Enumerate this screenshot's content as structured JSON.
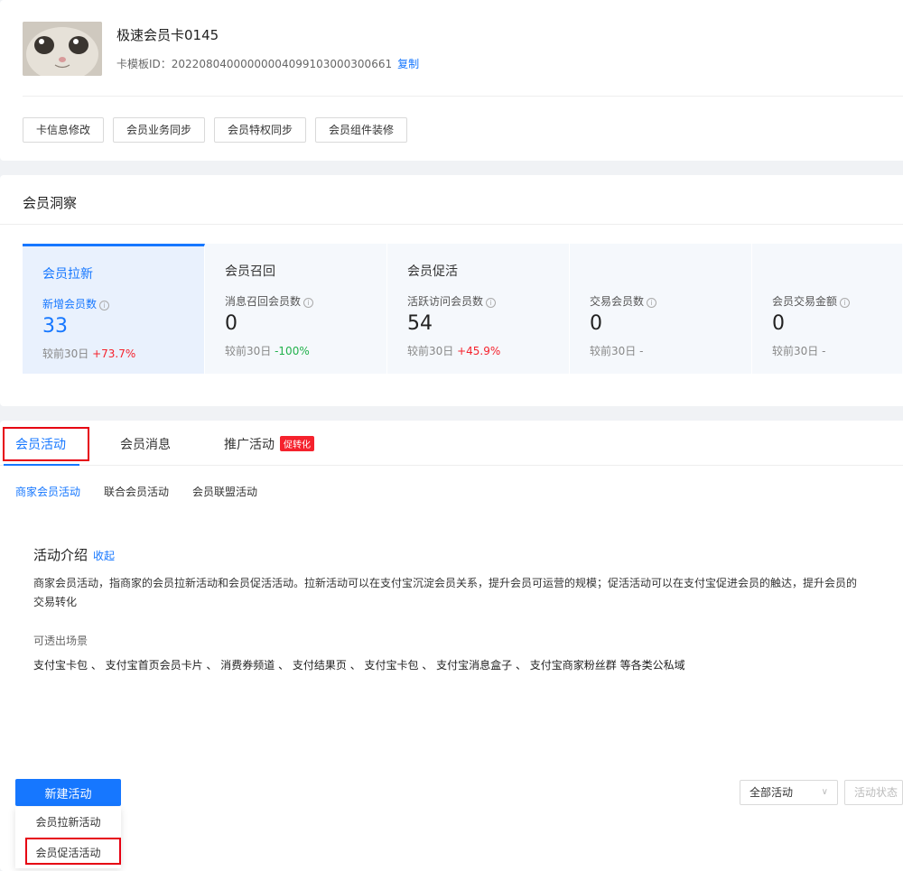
{
  "card": {
    "title": "极速会员卡0145",
    "template_label": "卡模板ID：",
    "template_id": "20220804000000004099103000300661",
    "copy": "复制",
    "buttons": [
      "卡信息修改",
      "会员业务同步",
      "会员特权同步",
      "会员组件装修"
    ]
  },
  "insight": {
    "title": "会员洞察",
    "stats": [
      {
        "group": "会员拉新",
        "label": "新增会员数",
        "value": "33",
        "compare_prefix": "较前30日 ",
        "change": "+73.7%",
        "trend": "up",
        "active": true
      },
      {
        "group": "会员召回",
        "label": "消息召回会员数",
        "value": "0",
        "compare_prefix": "较前30日 ",
        "change": "-100%",
        "trend": "down",
        "active": false
      },
      {
        "group": "会员促活",
        "label": "活跃访问会员数",
        "value": "54",
        "compare_prefix": "较前30日 ",
        "change": "+45.9%",
        "trend": "up",
        "active": false
      },
      {
        "group": "",
        "label": "交易会员数",
        "value": "0",
        "compare_prefix": "较前30日 ",
        "change": "-",
        "trend": "none",
        "active": false
      },
      {
        "group": "",
        "label": "会员交易金额",
        "value": "0",
        "compare_prefix": "较前30日 ",
        "change": "-",
        "trend": "none",
        "active": false
      }
    ]
  },
  "tabs": {
    "items": [
      "会员活动",
      "会员消息",
      "推广活动"
    ],
    "promo_badge": "促转化"
  },
  "subtabs": [
    "商家会员活动",
    "联合会员活动",
    "会员联盟活动"
  ],
  "intro": {
    "title": "活动介绍",
    "collapse": "收起",
    "text": "商家会员活动，指商家的会员拉新活动和会员促活活动。拉新活动可以在支付宝沉淀会员关系，提升会员可运营的规模；促活活动可以在支付宝促进会员的触达，提升会员的交易转化",
    "scene_title": "可透出场景",
    "scenes": "支付宝卡包 、 支付宝首页会员卡片 、 消费券频道 、 支付结果页 、 支付宝卡包 、 支付宝消息盒子 、 支付宝商家粉丝群 等各类公私域"
  },
  "actions": {
    "new_button": "新建活动",
    "menu": [
      "会员拉新活动",
      "会员促活活动"
    ],
    "filter_all": "全部活动",
    "filter_status": "活动状态"
  },
  "colors": {
    "accent": "#1677ff",
    "highlight_box": "#e60012",
    "up": "#f5222d",
    "down": "#22b14c"
  }
}
